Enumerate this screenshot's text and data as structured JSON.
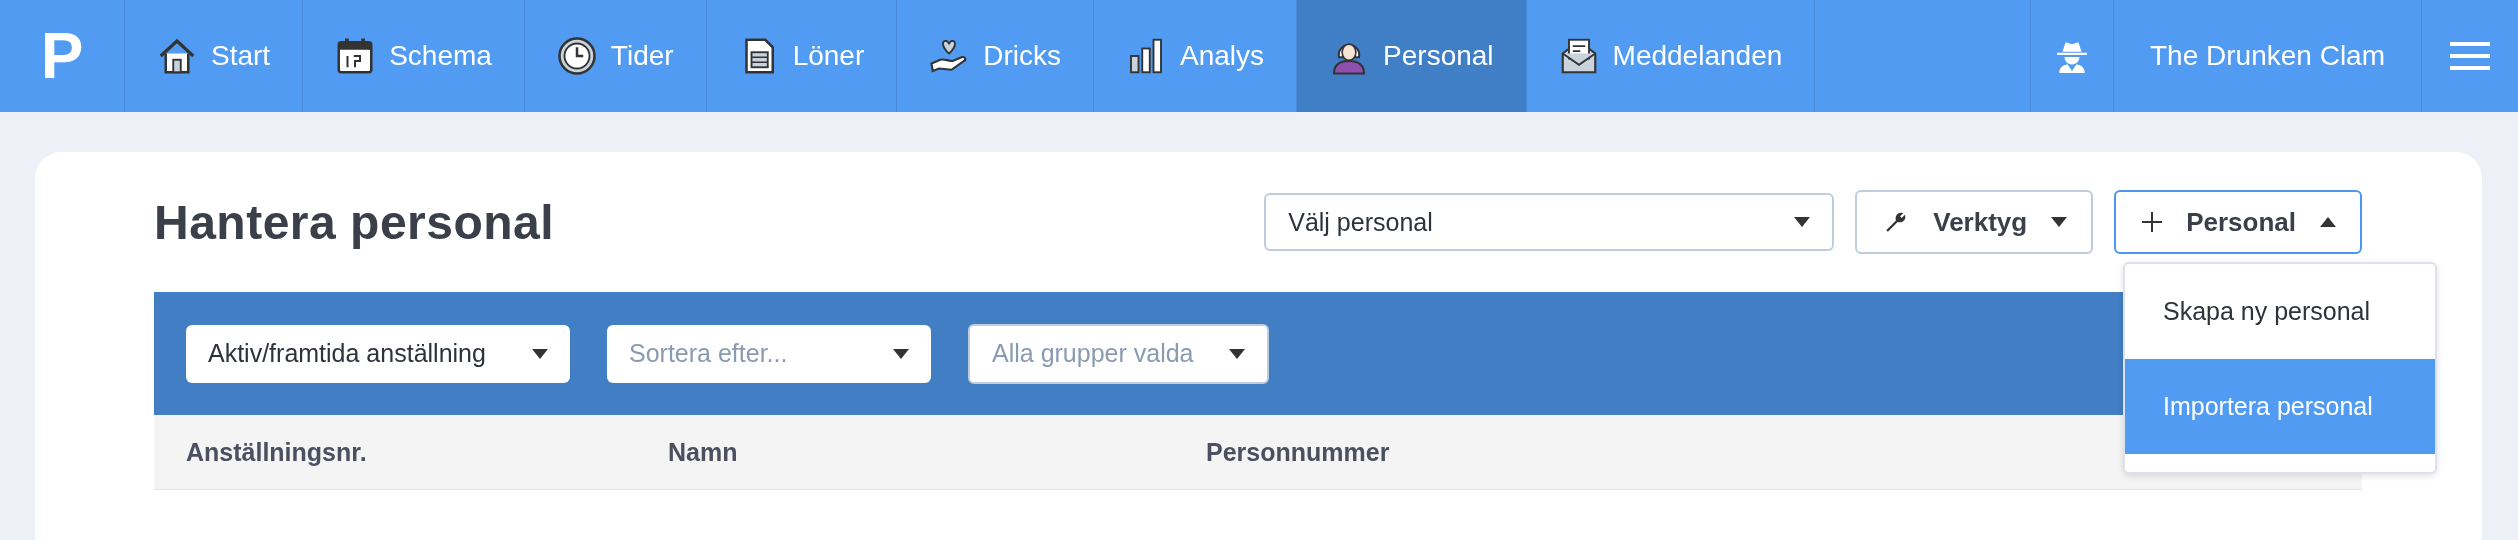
{
  "nav": {
    "logo": "P",
    "items": [
      {
        "label": "Start",
        "selected": false
      },
      {
        "label": "Schema",
        "selected": false
      },
      {
        "label": "Tider",
        "selected": false
      },
      {
        "label": "Löner",
        "selected": false
      },
      {
        "label": "Dricks",
        "selected": false
      },
      {
        "label": "Analys",
        "selected": false
      },
      {
        "label": "Personal",
        "selected": true
      },
      {
        "label": "Meddelanden",
        "selected": false
      }
    ],
    "account": "The Drunken Clam"
  },
  "page": {
    "title": "Hantera personal",
    "staff_select": {
      "value": "Välj personal"
    },
    "tools_button": {
      "label": "Verktyg"
    },
    "add_button": {
      "label": "Personal",
      "expanded": true,
      "menu": [
        {
          "label": "Skapa ny personal",
          "selected": false
        },
        {
          "label": "Importera personal",
          "selected": true
        }
      ]
    },
    "filters": [
      {
        "kind": "value",
        "text": "Aktiv/framtida anställning"
      },
      {
        "kind": "placeholder",
        "text": "Sortera efter..."
      },
      {
        "kind": "placeholder-outlined",
        "text": "Alla grupper valda"
      }
    ],
    "table": {
      "columns": [
        "Anställningsnr.",
        "Namn",
        "Personnummer"
      ]
    }
  }
}
